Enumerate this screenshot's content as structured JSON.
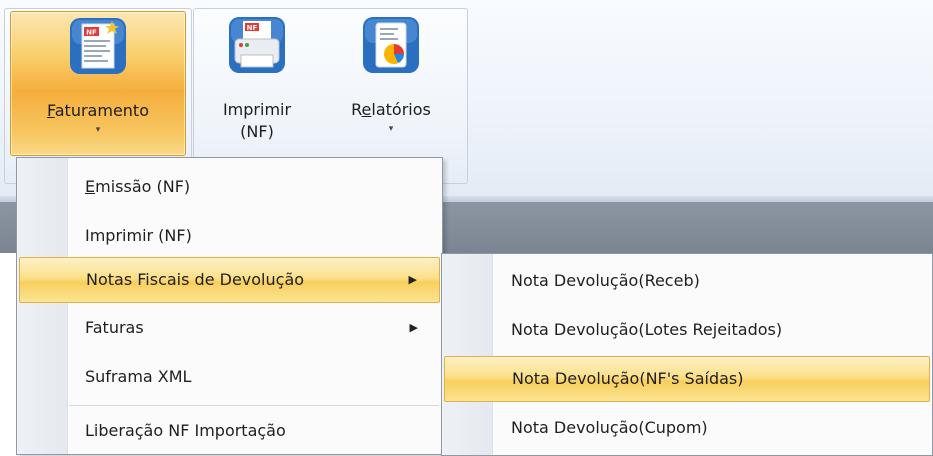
{
  "ribbon": {
    "buttons": [
      {
        "id": "faturamento",
        "label": "Faturamento",
        "accel": "F",
        "label_rest": "aturamento",
        "has_dropdown": true,
        "icon": "nf-document-icon",
        "state": "pressed"
      },
      {
        "id": "imprimir",
        "label_line1": "Imprimir",
        "label_line2": "(NF)",
        "has_dropdown": false,
        "icon": "nf-printer-icon"
      },
      {
        "id": "relatorios",
        "label": "Relatórios",
        "accel_prefix": "R",
        "accel": "e",
        "label_rest": "latórios",
        "has_dropdown": true,
        "icon": "report-chart-icon"
      }
    ],
    "dropdown_arrow": "▾"
  },
  "menu": {
    "items": [
      {
        "label": "Emissão (NF)",
        "accel": "E",
        "label_rest": "missão (NF)",
        "has_submenu": false
      },
      {
        "label": "Imprimir (NF)",
        "has_submenu": false
      },
      {
        "label": "Notas Fiscais de Devolução",
        "has_submenu": true,
        "highlighted": true
      },
      {
        "label": "Faturas",
        "has_submenu": true
      },
      {
        "label": "Suframa XML",
        "has_submenu": false
      },
      {
        "label": "Liberação NF Importação",
        "has_submenu": false
      }
    ],
    "submenu_arrow": "▶"
  },
  "submenu": {
    "items": [
      {
        "label": "Nota Devolução(Receb)"
      },
      {
        "label": "Nota Devolução(Lotes Rejeitados)"
      },
      {
        "label": "Nota Devolução(NF's Saídas)",
        "highlighted": true
      },
      {
        "label": "Nota Devolução(Cupom)"
      }
    ]
  },
  "colors": {
    "highlight": "#f8cf5c",
    "ribbon_bg": "#eef3fa",
    "dark_band": "#848e9a",
    "icon_blue": "#2a6fc0"
  }
}
